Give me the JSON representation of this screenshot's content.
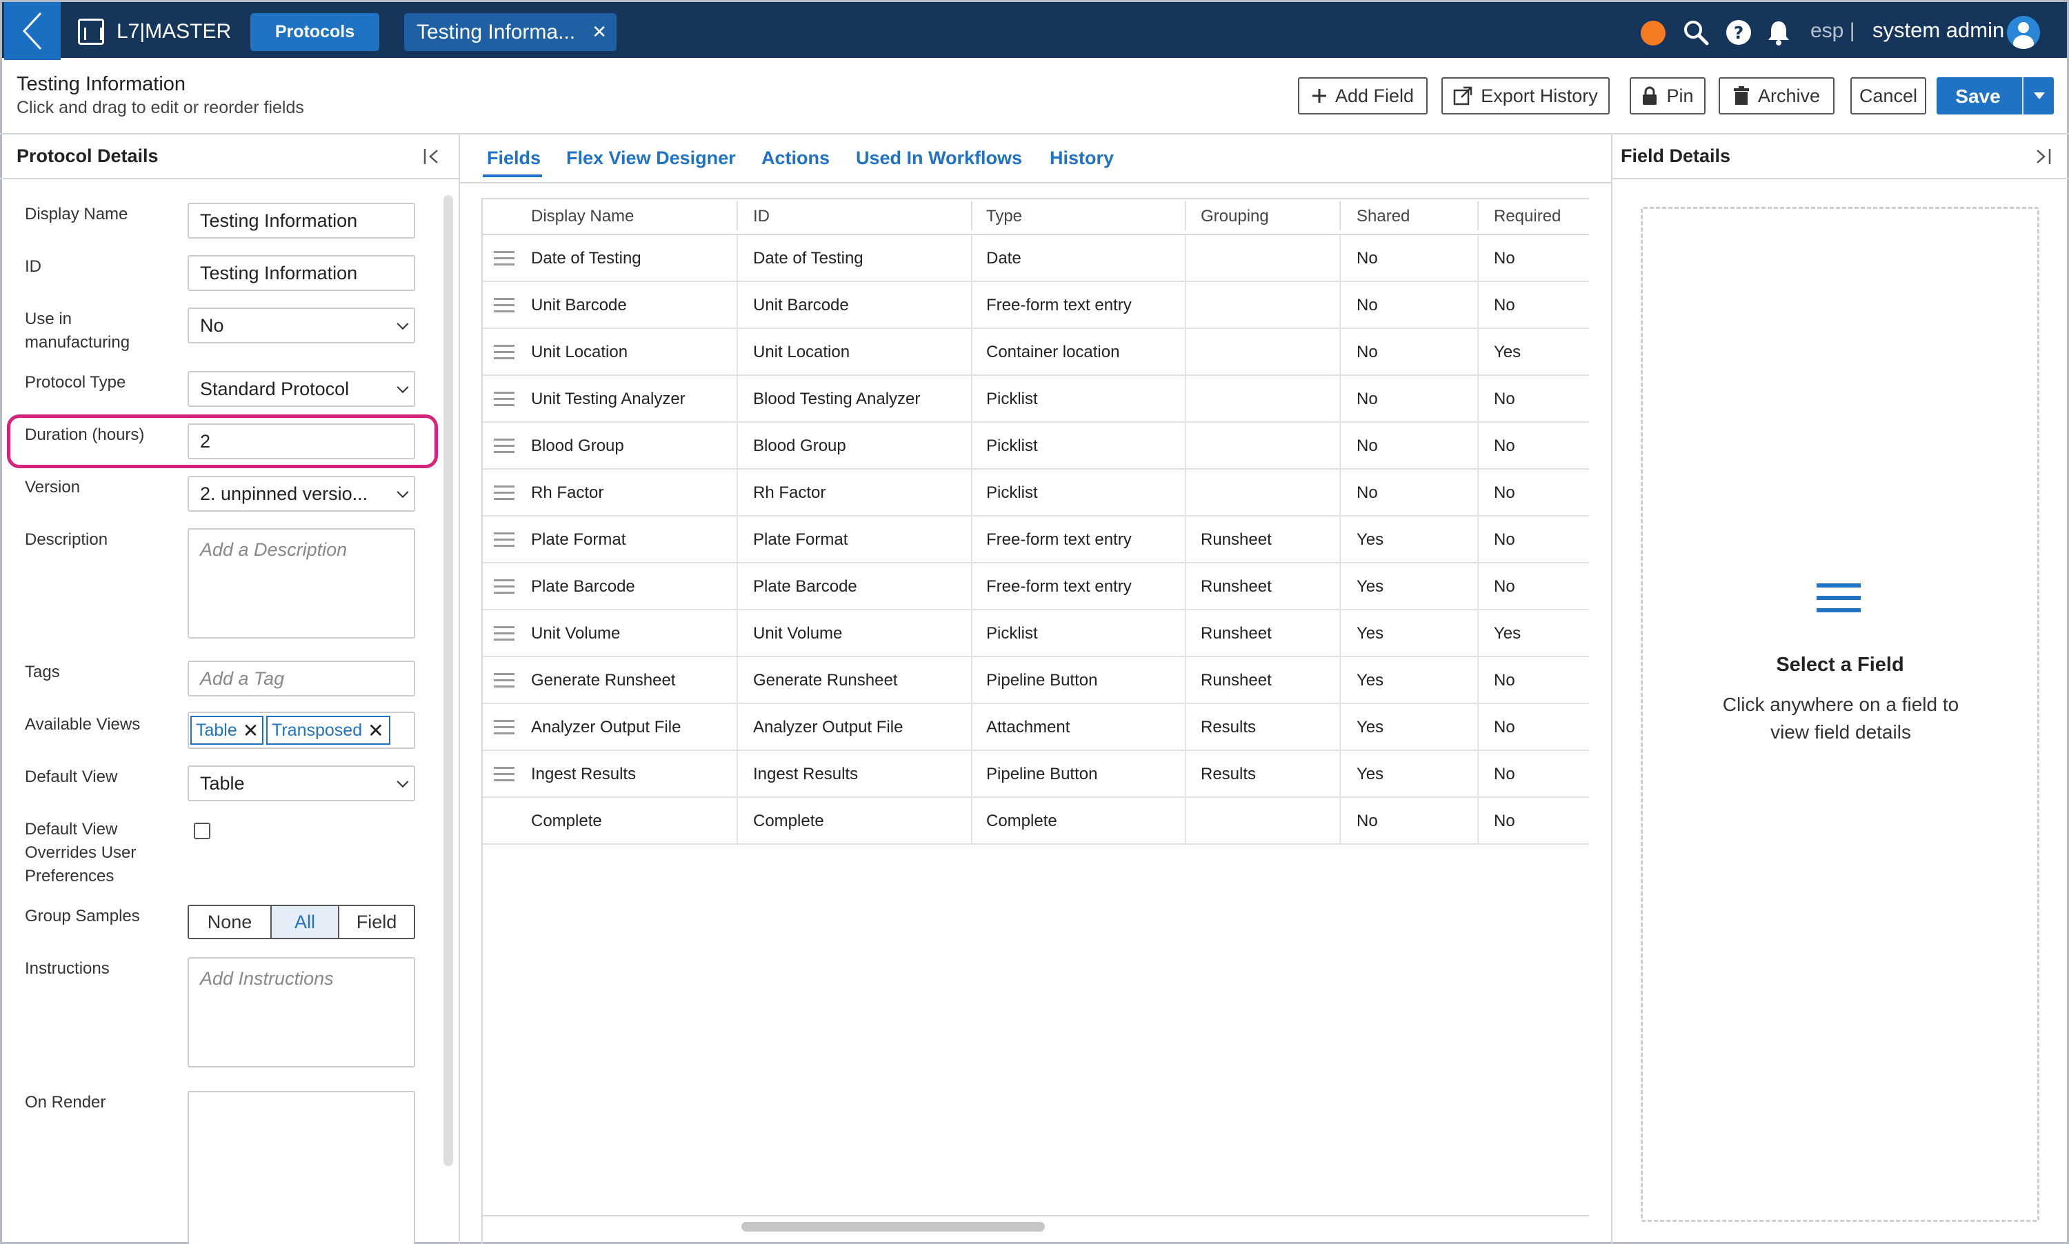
{
  "topbar": {
    "app_name": "L7|MASTER",
    "protocols_tab": "Protocols",
    "open_tab": "Testing Informa...",
    "close_glyph": "✕",
    "lang": "esp |",
    "user": "system admin",
    "icons": [
      "back-chevron-icon",
      "app-grid-icon",
      "status-dot-icon",
      "search-icon",
      "help-icon",
      "bell-icon",
      "user-avatar-icon"
    ],
    "status_color": "#f47b20",
    "nav_color": "#16355a",
    "accent": "#1f72c4"
  },
  "header": {
    "title": "Testing Information",
    "subtitle": "Click and drag to edit or reorder fields",
    "buttons": {
      "add_field": "Add Field",
      "export_history": "Export History",
      "pin": "Pin",
      "archive": "Archive",
      "cancel": "Cancel",
      "save": "Save"
    }
  },
  "left": {
    "title": "Protocol Details",
    "labels": {
      "display_name": "Display Name",
      "id": "ID",
      "use_in_mfg_1": "Use in",
      "use_in_mfg_2": "manufacturing",
      "protocol_type": "Protocol Type",
      "duration": "Duration (hours)",
      "version": "Version",
      "description": "Description",
      "tags": "Tags",
      "available_views": "Available Views",
      "default_view": "Default View",
      "overrides_1": "Default View",
      "overrides_2": "Overrides User",
      "overrides_3": "Preferences",
      "group_samples": "Group Samples",
      "instructions": "Instructions",
      "on_render": "On Render"
    },
    "values": {
      "display_name": "Testing Information",
      "id": "Testing Information",
      "use_in_mfg": "No",
      "protocol_type": "Standard Protocol",
      "duration": "2",
      "version": "2. unpinned versio...",
      "default_view": "Table"
    },
    "placeholders": {
      "description": "Add a Description",
      "tags": "Add a Tag",
      "instructions": "Add Instructions"
    },
    "views": [
      "Table",
      "Transposed"
    ],
    "chip_remove": "✕",
    "group_samples_options": [
      "None",
      "All",
      "Field"
    ],
    "group_samples_selected": "All",
    "overrides_checked": false,
    "highlight_color": "#d6247a"
  },
  "tabs": [
    "Fields",
    "Flex View Designer",
    "Actions",
    "Used In Workflows",
    "History"
  ],
  "active_tab": "Fields",
  "table": {
    "columns": [
      "Display Name",
      "ID",
      "Type",
      "Grouping",
      "Shared",
      "Required"
    ],
    "rows": [
      [
        "Date of Testing",
        "Date of Testing",
        "Date",
        "",
        "No",
        "No"
      ],
      [
        "Unit Barcode",
        "Unit Barcode",
        "Free-form text entry",
        "",
        "No",
        "No"
      ],
      [
        "Unit Location",
        "Unit Location",
        "Container location",
        "",
        "No",
        "Yes"
      ],
      [
        "Unit Testing Analyzer",
        "Blood Testing Analyzer",
        "Picklist",
        "",
        "No",
        "No"
      ],
      [
        "Blood Group",
        "Blood Group",
        "Picklist",
        "",
        "No",
        "No"
      ],
      [
        "Rh Factor",
        "Rh Factor",
        "Picklist",
        "",
        "No",
        "No"
      ],
      [
        "Plate Format",
        "Plate Format",
        "Free-form text entry",
        "Runsheet",
        "Yes",
        "No"
      ],
      [
        "Plate Barcode",
        "Plate Barcode",
        "Free-form text entry",
        "Runsheet",
        "Yes",
        "No"
      ],
      [
        "Unit Volume",
        "Unit Volume",
        "Picklist",
        "Runsheet",
        "Yes",
        "Yes"
      ],
      [
        "Generate Runsheet",
        "Generate Runsheet",
        "Pipeline Button",
        "Runsheet",
        "Yes",
        "No"
      ],
      [
        "Analyzer Output File",
        "Analyzer Output File",
        "Attachment",
        "Results",
        "Yes",
        "No"
      ],
      [
        "Ingest Results",
        "Ingest Results",
        "Pipeline Button",
        "Results",
        "Yes",
        "No"
      ],
      [
        "Complete",
        "Complete",
        "Complete",
        "",
        "No",
        "No"
      ]
    ],
    "draggable_rows": 12
  },
  "right": {
    "title": "Field Details",
    "empty_title": "Select a Field",
    "empty_desc": "Click anywhere on a field to view field details"
  }
}
